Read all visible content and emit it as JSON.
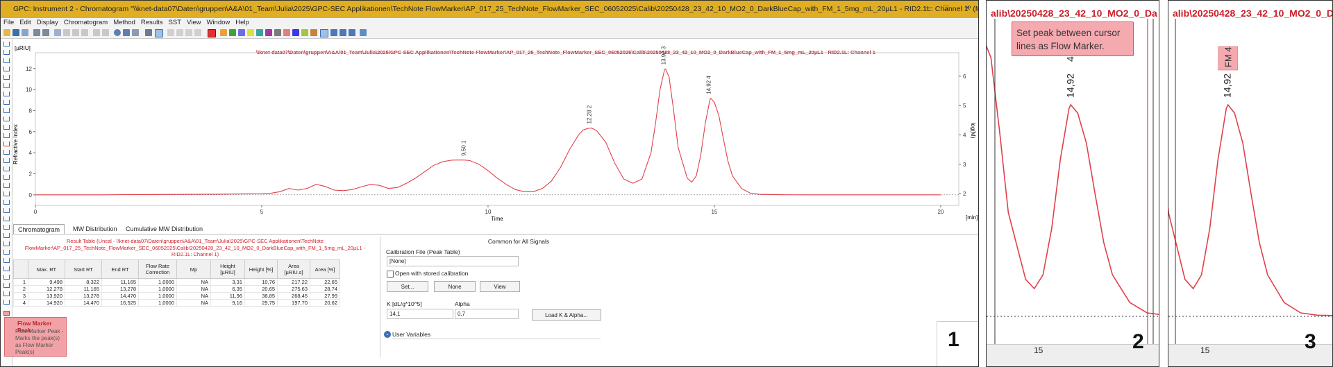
{
  "window": {
    "title": "GPC: Instrument 2 - Chromatogram \"\\\\knet-data07\\Daten\\gruppen\\A&A\\01_Team\\Julia\\2025\\GPC-SEC Applikationen\\TechNote FlowMarker\\AP_017_25_TechNote_FlowMarker_SEC_06052025\\Calib\\20250428_23_42_10_MO2_0_DarkBlueCap_with_FM_1_5mg_mL_20µL1 - RID2.1L: Channel 1\" (MODIFIED)"
  },
  "menu": [
    "File",
    "Edit",
    "Display",
    "Chromatogram",
    "Method",
    "Results",
    "SST",
    "View",
    "Window",
    "Help"
  ],
  "chart": {
    "title": "\\\\knet-data07\\Daten\\gruppen\\A&A\\01_Team\\Julia\\2025\\GPC-SEC Applikationen\\TechNote FlowMarker\\AP_017_25_TechNote_FlowMarker_SEC_06052025\\Calib\\20250428_23_42_10_MO2_0_DarkBlueCap_with_FM_1_5mg_mL_20µL1 - RID2.1L: Channel 1",
    "y_label": "Refractive Index",
    "y_unit": "[µRIU]",
    "x_label": "Time",
    "x_unit": "[min]",
    "y2_label": "log(M)",
    "peak_labels": [
      {
        "rt": "9,50",
        "num": "1"
      },
      {
        "rt": "12,28",
        "num": "2"
      },
      {
        "rt": "13,92",
        "num": "3"
      },
      {
        "rt": "14,92",
        "num": "4"
      }
    ]
  },
  "chart_data": {
    "type": "line",
    "x_ticks": [
      0,
      5,
      10,
      15,
      20
    ],
    "y_ticks": [
      0,
      2,
      4,
      6,
      8,
      10,
      12
    ],
    "y2_ticks": [
      2,
      3,
      4,
      5,
      6
    ],
    "xlim": [
      0,
      20.4
    ],
    "ylim": [
      -1,
      13.5
    ],
    "x": [
      0,
      0.5,
      1,
      1.5,
      2,
      2.5,
      3,
      3.5,
      4,
      4.5,
      5,
      5.2,
      5.4,
      5.6,
      5.8,
      6,
      6.2,
      6.4,
      6.6,
      6.8,
      7,
      7.2,
      7.4,
      7.6,
      7.8,
      8,
      8.2,
      8.4,
      8.6,
      8.8,
      9,
      9.2,
      9.4,
      9.5,
      9.6,
      9.8,
      10,
      10.2,
      10.4,
      10.6,
      10.8,
      11,
      11.2,
      11.4,
      11.6,
      11.8,
      12,
      12.1,
      12.2,
      12.28,
      12.4,
      12.6,
      12.8,
      13,
      13.2,
      13.4,
      13.6,
      13.7,
      13.8,
      13.9,
      13.92,
      14,
      14.1,
      14.2,
      14.4,
      14.5,
      14.6,
      14.7,
      14.8,
      14.9,
      14.92,
      15,
      15.1,
      15.2,
      15.3,
      15.4,
      15.6,
      15.8,
      16,
      16.5,
      17,
      18,
      19,
      20
    ],
    "y": [
      0,
      0,
      0,
      0,
      0.02,
      0.03,
      0.04,
      0.05,
      0.06,
      0.08,
      0.1,
      0.15,
      0.3,
      0.6,
      0.45,
      0.6,
      1.0,
      0.8,
      0.45,
      0.4,
      0.5,
      0.75,
      1.0,
      0.9,
      0.6,
      0.7,
      1.1,
      1.6,
      2.2,
      2.8,
      3.15,
      3.3,
      3.31,
      3.3,
      3.25,
      2.9,
      2.3,
      1.6,
      1.0,
      0.5,
      0.3,
      0.3,
      0.6,
      1.3,
      2.6,
      4.3,
      5.7,
      6.15,
      6.3,
      6.35,
      6.1,
      5.0,
      3.0,
      1.5,
      1.1,
      1.5,
      4.0,
      6.8,
      10.0,
      11.9,
      11.96,
      11.2,
      8.0,
      4.5,
      1.6,
      1.2,
      1.8,
      3.8,
      6.8,
      9.0,
      9.16,
      8.8,
      7.5,
      5.3,
      3.2,
      1.8,
      0.6,
      0.15,
      0.05,
      0.01,
      0,
      0,
      0,
      0
    ]
  },
  "tabs": [
    "Chromatogram",
    "MW Distribution",
    "Cumulative MW Distribution"
  ],
  "result": {
    "title": "Result Table (Uncal - \\\\knet-data07\\Daten\\gruppen\\A&A\\01_Team\\Julia\\2025\\GPC-SEC Applikationen\\TechNote FlowMarker\\AP_017_25_TechNote_FlowMarker_SEC_06052025\\Calib\\20250428_23_42_10_MO2_0_DarkBlueCap_with_FM_1_5mg_mL_20µL1 - RID2.1L: Channel 1)",
    "headers": [
      "",
      "Max. RT",
      "Start RT",
      "End RT",
      "Flow Rate Correction",
      "Mp",
      "Height [µRIU]",
      "Height [%]",
      "Area [µRIU.s]",
      "Area [%]"
    ],
    "rows": [
      [
        "1",
        "9,498",
        "8,322",
        "11,165",
        "1,0000",
        "NA",
        "3,31",
        "10,76",
        "217,22",
        "22,65"
      ],
      [
        "2",
        "12,278",
        "11,165",
        "13,278",
        "1,0000",
        "NA",
        "6,35",
        "20,65",
        "275,63",
        "28,74"
      ],
      [
        "3",
        "13,920",
        "13,278",
        "14,470",
        "1,0000",
        "NA",
        "11,96",
        "38,85",
        "268,45",
        "27,99"
      ],
      [
        "4",
        "14,920",
        "14,470",
        "16,525",
        "1,0000",
        "NA",
        "9,16",
        "29,75",
        "197,70",
        "20,62"
      ]
    ]
  },
  "common": {
    "title": "Common for All Signals",
    "calibration_file_label": "Calibration File (Peak Table)",
    "calibration_file_value": "[None]",
    "open_stored_label": "Open with stored calibration",
    "set_button": "Set...",
    "none_button": "None",
    "view_button": "View",
    "k_label": "K [dL/g*10^5]",
    "k_value": "14,1",
    "alpha_label": "Alpha",
    "alpha_value": "0,7",
    "load_button": "Load K & Alpha...",
    "user_variables": "User Variables"
  },
  "tooltip": {
    "title": "Flow Marker Peak",
    "body": "Flow Marker Peak - Marks the peak(s) as Flow Marker Peak(s)"
  },
  "panel2": {
    "header": "alib\\20250428_23_42_10_MO2_0_Da",
    "callout": "Set peak between cursor lines as Flow Marker.",
    "peak_rt": "14,92",
    "peak_num": "4",
    "x_tick": "15",
    "step": "2"
  },
  "panel3": {
    "header": "alib\\20250428_23_42_10_MO2_0_Da",
    "fm_label": "FM 4",
    "peak_rt": "14,92",
    "x_tick": "15",
    "step": "3"
  },
  "panel1_step": "1",
  "colors": {
    "trace": "#e0404a",
    "titlebar": "#e0ae22",
    "accent_red": "#cc1f2a",
    "callout": "#f5aab0"
  }
}
